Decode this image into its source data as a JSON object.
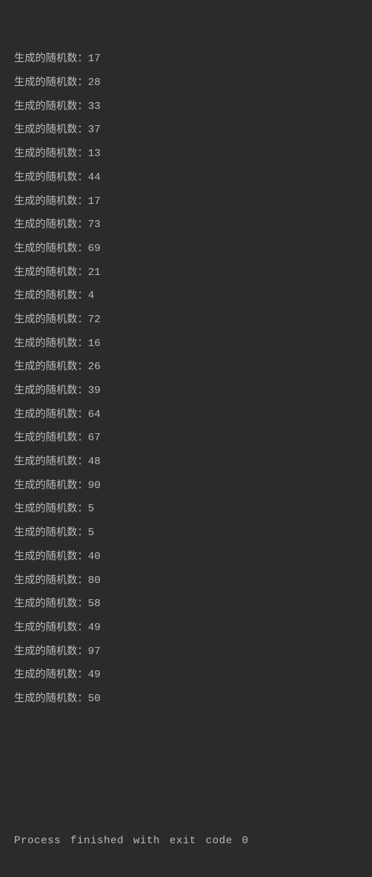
{
  "output": {
    "prefix": "生成的随机数：",
    "lines": [
      {
        "value": "17"
      },
      {
        "value": "28"
      },
      {
        "value": "33"
      },
      {
        "value": "37"
      },
      {
        "value": "13"
      },
      {
        "value": "44"
      },
      {
        "value": "17"
      },
      {
        "value": "73"
      },
      {
        "value": "69"
      },
      {
        "value": "21"
      },
      {
        "value": "4"
      },
      {
        "value": "72"
      },
      {
        "value": "16"
      },
      {
        "value": "26"
      },
      {
        "value": "39"
      },
      {
        "value": "64"
      },
      {
        "value": "67"
      },
      {
        "value": "48"
      },
      {
        "value": "90"
      },
      {
        "value": "5"
      },
      {
        "value": "5"
      },
      {
        "value": "40"
      },
      {
        "value": "80"
      },
      {
        "value": "58"
      },
      {
        "value": "49"
      },
      {
        "value": "97"
      },
      {
        "value": "49"
      },
      {
        "value": "50"
      }
    ]
  },
  "status": {
    "message": "Process finished with exit code 0"
  }
}
